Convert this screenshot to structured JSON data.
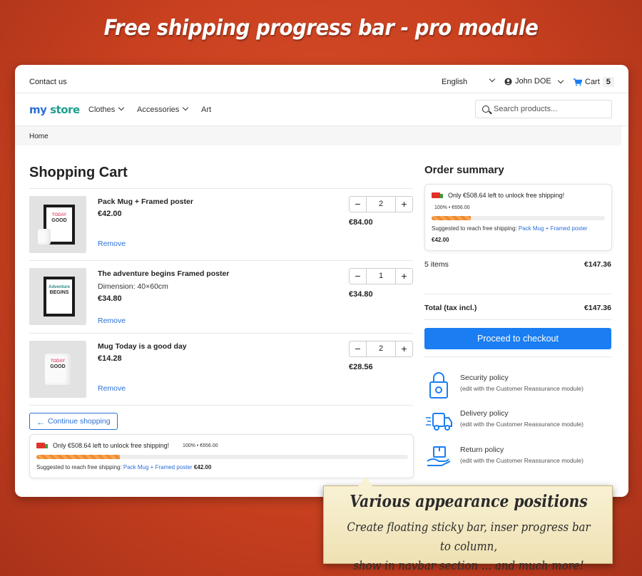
{
  "banner": {
    "title": "Free shipping progress bar - pro module",
    "callout_title": "Various appearance positions",
    "callout_line1": "Create floating sticky bar, inser progress bar to column,",
    "callout_line2": "show in navbar section ... and much more!"
  },
  "topbar": {
    "contact": "Contact us",
    "language": "English",
    "user": "John DOE",
    "cart_label": "Cart",
    "cart_count": "5"
  },
  "navbar": {
    "logo_parts": [
      "my",
      " ",
      "store"
    ],
    "menu": [
      "Clothes",
      "Accessories",
      "Art"
    ],
    "search_placeholder": "Search products..."
  },
  "breadcrumb": "Home",
  "cart": {
    "title": "Shopping Cart",
    "items": [
      {
        "name": "Pack Mug + Framed poster",
        "dimension": "",
        "price": "€42.00",
        "qty": "2",
        "total": "€84.00",
        "remove": "Remove",
        "img_text1": "TODAY",
        "img_text2": "GOOD"
      },
      {
        "name": "The adventure begins Framed poster",
        "dimension": "Dimension: 40×60cm",
        "price": "€34.80",
        "qty": "1",
        "total": "€34.80",
        "remove": "Remove",
        "img_text1": "Adventure",
        "img_text2": "BEGINS"
      },
      {
        "name": "Mug Today is a good day",
        "dimension": "",
        "price": "€14.28",
        "qty": "2",
        "total": "€28.56",
        "remove": "Remove",
        "img_text1": "TODAY",
        "img_text2": "GOOD"
      }
    ],
    "continue": "Continue shopping"
  },
  "free_shipping": {
    "message": "Only €508.64 left to unlock free shipping!",
    "progress_label": "100% • €656.00",
    "progress_fraction": 0.225,
    "suggest_label": "Suggested to reach free shipping:",
    "suggest_product": "Pack Mug + Framed poster",
    "suggest_price": "€42.00"
  },
  "summary": {
    "title": "Order summary",
    "items_label": "5 items",
    "items_value": "€147.36",
    "total_label": "Total (tax incl.)",
    "total_value": "€147.36",
    "checkout": "Proceed to checkout"
  },
  "reassurance": [
    {
      "title": "Security policy",
      "subtitle": "(edit with the Customer Reassurance module)"
    },
    {
      "title": "Delivery policy",
      "subtitle": "(edit with the Customer Reassurance module)"
    },
    {
      "title": "Return policy",
      "subtitle": "(edit with the Customer Reassurance module)"
    }
  ],
  "colors": {
    "accent": "#1a7ef2",
    "link": "#2a6fd6",
    "progress": "#f08a2c",
    "background": "#c8401f"
  }
}
